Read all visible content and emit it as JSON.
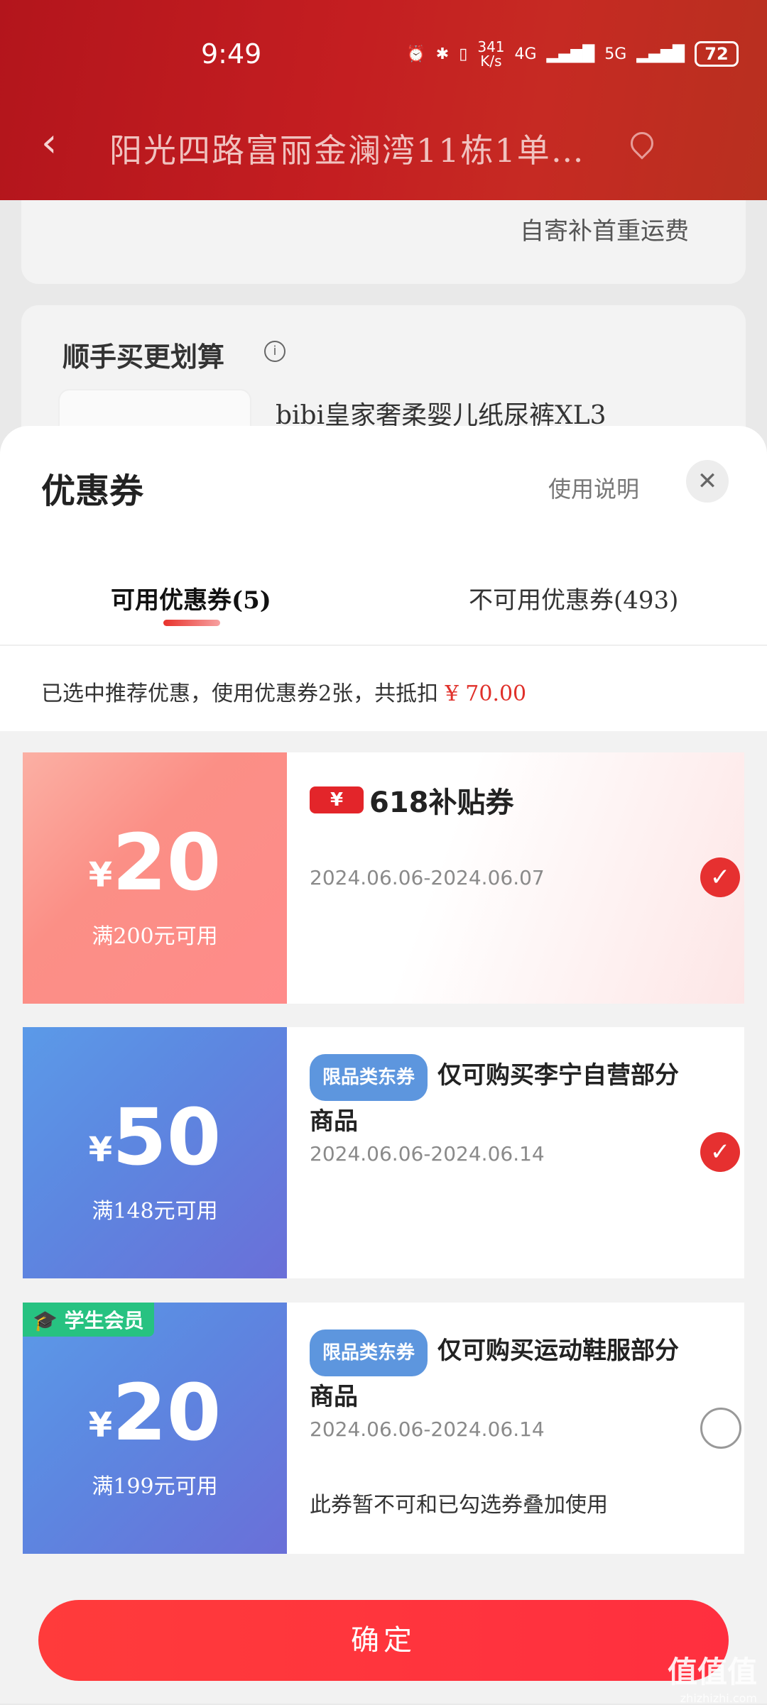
{
  "status_bar": {
    "time": "9:49",
    "net_speed_top": "341",
    "net_speed_bottom": "K/s",
    "signal_1": "4G",
    "signal_2": "5G",
    "battery": "72"
  },
  "nav": {
    "address": "阳光四路富丽金澜湾11栋1单…"
  },
  "background_card": {
    "shipping_note": "自寄补首重运费"
  },
  "upsell": {
    "title": "顺手买更划算",
    "product": "bibi皇家奢柔婴儿纸尿裤XL3"
  },
  "sheet": {
    "title": "优惠券",
    "help": "使用说明",
    "tabs": [
      {
        "label": "可用优惠券(5)"
      },
      {
        "label": "不可用优惠券(493)"
      }
    ],
    "summary_prefix": "已选中推荐优惠，使用优惠券2张，共抵扣",
    "summary_amount": "¥ 70.00"
  },
  "coupons": [
    {
      "currency": "¥",
      "amount": "20",
      "condition": "满200元可用",
      "badge_symbol": "¥",
      "badge_text": "618补贴券",
      "date": "2024.06.06-2024.06.07",
      "checked": true
    },
    {
      "currency": "¥",
      "amount": "50",
      "condition": "满148元可用",
      "tag": "限品类东券",
      "desc": "仅可购买李宁自营部分商品",
      "date": "2024.06.06-2024.06.14",
      "checked": true
    },
    {
      "currency": "¥",
      "amount": "20",
      "condition": "满199元可用",
      "student_tag": "学生会员",
      "tag": "限品类东券",
      "desc": "仅可购买运动鞋服部分商品",
      "date": "2024.06.06-2024.06.14",
      "note": "此券暂不可和已勾选券叠加使用",
      "checked": false
    }
  ],
  "confirm_label": "确定",
  "watermark": {
    "main": "值值值",
    "sub": "zhizhizhi.com"
  },
  "colors": {
    "accent_red": "#e63030",
    "tag_blue": "#5d96de",
    "student_green": "#27c281"
  }
}
